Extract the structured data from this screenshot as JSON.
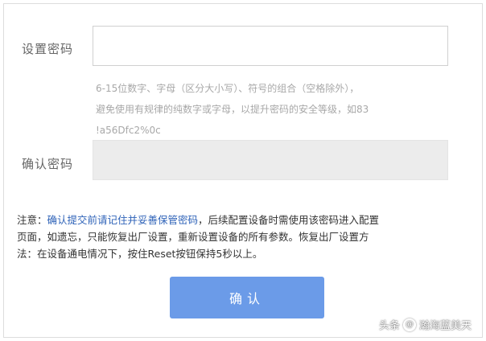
{
  "form": {
    "password_label": "设置密码",
    "password_value": "",
    "confirm_label": "确认密码",
    "confirm_value": "",
    "hint_lines": [
      "6-15位数字、字母（区分大小写）、符号的组合（空格除外），",
      "避免使用有规律的纯数字或字母，以提升密码的安全等级，如83",
      "!a56Dfc2%0c"
    ]
  },
  "note": {
    "prefix": "注意：",
    "highlight": "确认提交前请记住并妥善保管密码",
    "line1_rest": "，后续配置设备时需使用该密码进入配置",
    "line2": "页面，如遗忘，只能恢复出厂设置，重新设置设备的所有参数。恢复出厂设置方",
    "line3": "法：在设备通电情况下，按住Reset按钮保持5秒以上。"
  },
  "submit_label": "确认",
  "watermark": {
    "prefix": "头条",
    "at_symbol": "@",
    "author": "瀚海蓝美天"
  },
  "colors": {
    "button": "#6b9be8",
    "highlight": "#2f63b8"
  }
}
